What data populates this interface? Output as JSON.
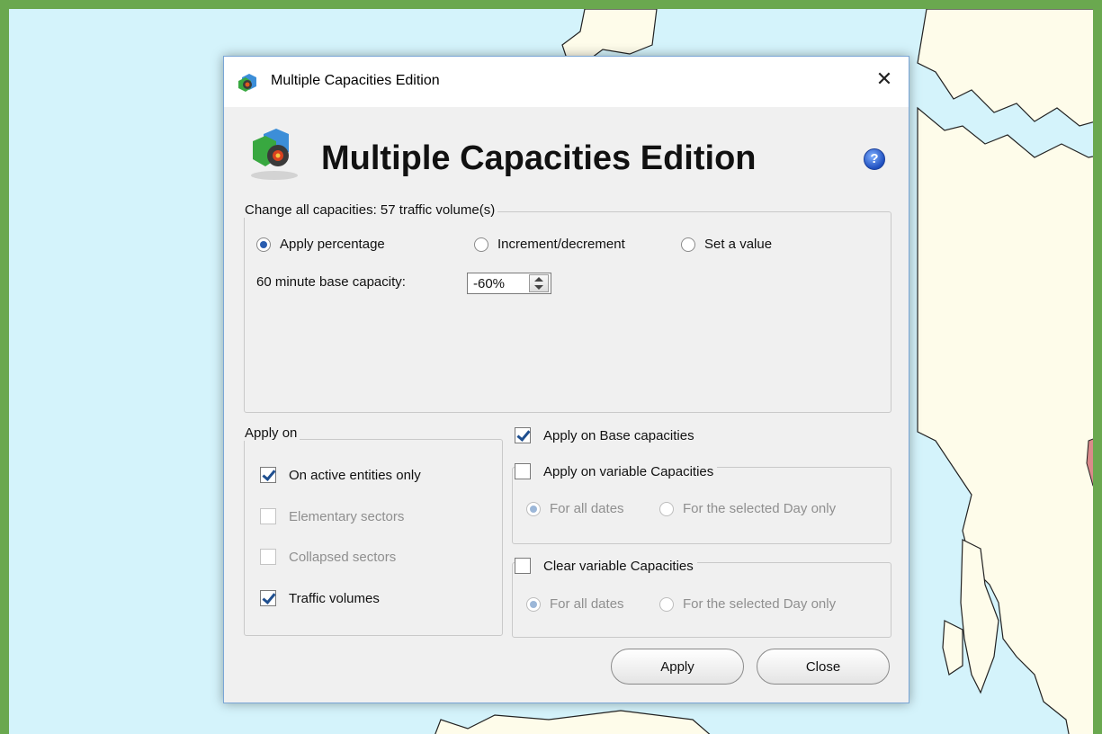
{
  "window": {
    "title": "Multiple Capacities Edition",
    "close_glyph": "✕"
  },
  "header": {
    "heading": "Multiple Capacities Edition",
    "help_glyph": "?"
  },
  "change_group": {
    "legend": "Change all capacities: 57 traffic volume(s)",
    "mode_options": [
      {
        "label": "Apply percentage",
        "selected": true
      },
      {
        "label": "Increment/decrement",
        "selected": false
      },
      {
        "label": "Set a value",
        "selected": false
      }
    ],
    "base_capacity_label": "60 minute base capacity:",
    "base_capacity_value": "-60%"
  },
  "apply_on_group": {
    "legend": "Apply on",
    "items": [
      {
        "label": "On active entities only",
        "checked": true,
        "enabled": true
      },
      {
        "label": "Elementary sectors",
        "checked": false,
        "enabled": false
      },
      {
        "label": "Collapsed sectors",
        "checked": false,
        "enabled": false
      },
      {
        "label": "Traffic volumes",
        "checked": true,
        "enabled": true
      }
    ]
  },
  "base_capacities": {
    "label": "Apply on Base capacities",
    "checked": true
  },
  "variable_capacities": {
    "label": "Apply on variable Capacities",
    "checked": false,
    "options": [
      {
        "label": "For all dates",
        "selected": true
      },
      {
        "label": "For the selected Day only",
        "selected": false
      }
    ]
  },
  "clear_variable": {
    "label": "Clear variable Capacities",
    "checked": false,
    "options": [
      {
        "label": "For all dates",
        "selected": true
      },
      {
        "label": "For the selected Day only",
        "selected": false
      }
    ]
  },
  "buttons": {
    "apply": "Apply",
    "close": "Close"
  },
  "colors": {
    "frame_border": "#6aa84f",
    "sea": "#d4f3fb",
    "land": "#fefcea",
    "highlight_region": "#d98a8a"
  }
}
